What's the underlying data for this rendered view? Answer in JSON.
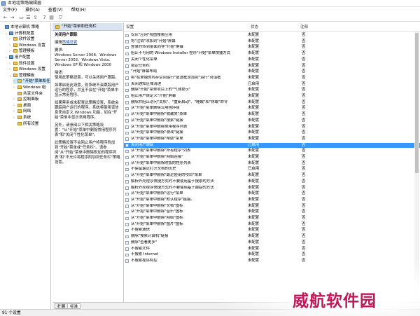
{
  "window": {
    "title": "本地组策略编辑器"
  },
  "menu": [
    "文件(F)",
    "操作(A)",
    "查看(V)",
    "帮助(H)"
  ],
  "tree": [
    {
      "label": "本地计算机 策略",
      "kind": "pc",
      "exp": "",
      "indent": 0
    },
    {
      "label": "计算机配置",
      "kind": "pc",
      "exp": "⌄",
      "indent": 1
    },
    {
      "label": "软件设置",
      "kind": "folder",
      "exp": "›",
      "indent": 2
    },
    {
      "label": "Windows 设置",
      "kind": "folder",
      "exp": "›",
      "indent": 2
    },
    {
      "label": "管理模板",
      "kind": "folder",
      "exp": "›",
      "indent": 2
    },
    {
      "label": "用户配置",
      "kind": "pc",
      "exp": "⌄",
      "indent": 1
    },
    {
      "label": "软件设置",
      "kind": "folder",
      "exp": "›",
      "indent": 2
    },
    {
      "label": "Windows 设置",
      "kind": "folder",
      "exp": "›",
      "indent": 2
    },
    {
      "label": "管理模板",
      "kind": "folder",
      "exp": "⌄",
      "indent": 2
    },
    {
      "label": "\"开始\"菜单和任",
      "kind": "folder",
      "exp": "›",
      "indent": 3,
      "selected": true
    },
    {
      "label": "Windows 组",
      "kind": "folder",
      "exp": "›",
      "indent": 3
    },
    {
      "label": "共享文件夹",
      "kind": "folder",
      "exp": "",
      "indent": 3
    },
    {
      "label": "控制面板",
      "kind": "folder",
      "exp": "›",
      "indent": 3
    },
    {
      "label": "桌面",
      "kind": "folder",
      "exp": "›",
      "indent": 3
    },
    {
      "label": "网络",
      "kind": "folder",
      "exp": "›",
      "indent": 3
    },
    {
      "label": "系统",
      "kind": "folder",
      "exp": "›",
      "indent": 3
    },
    {
      "label": "所有设置",
      "kind": "folder",
      "exp": "",
      "indent": 3
    }
  ],
  "description": {
    "header": "\"开始\"菜单和任务栏",
    "policy_title": "关闭用户跟踪",
    "edit_prefix": "编辑",
    "edit_link": "策略设置",
    "req_label": "要求:",
    "req_text": "Windows Server 2008、Windows Server 2003、Windows Vista、Windows XP 和 Windows 2000",
    "desc_label": "描述:",
    "desc_text": "使用此策略设置，可以关闭用户跟踪。",
    "p1": "如果启用此设置，则系统不会跟踪用户运行的程序，并且不会在\"开始\"菜单中显示常用程序。",
    "p2": "如果禁用或未配置此策略设置，系统会跟踪用户运行的程序。系统将使用该信息来自定义 Windows 功能，如在\"开始\"菜单中显示常用程序。",
    "p3": "另外，请参阅以下相关策略设置：\"从\"开始\"菜单中删除常用程序列表\"和\"关闭个性化菜单\"。",
    "p4": "此策略设置不会阻止用户将程序附加到\"开始\"菜单或\"任务栏\"。请参阅\"从\"开始\"菜单中删除附加的程序列表\"和\"不允许将程序附加到任务栏\"策略设置。"
  },
  "list_headers": {
    "setting": "设置",
    "state": "状态",
    "comment": "注释"
  },
  "rows": [
    {
      "name": "仅从\"应用\"视图搜索应用",
      "state": "未配置",
      "comment": "否"
    },
    {
      "name": "将\"注销\"添加到\"开始\"屏幕",
      "state": "未配置",
      "comment": "否"
    },
    {
      "name": "登录时转到桌面而非\"开始\"屏幕",
      "state": "未配置",
      "comment": "否"
    },
    {
      "name": "阻止不可用的 Windows Installer 程序\"开始\"菜单快捷方式",
      "state": "未配置",
      "comment": "否"
    },
    {
      "name": "关闭个性化菜单",
      "state": "未配置",
      "comment": "否"
    },
    {
      "name": "锁定任务栏",
      "state": "未配置",
      "comment": "否"
    },
    {
      "name": "\"开始\"屏幕布局",
      "state": "未配置",
      "comment": "否"
    },
    {
      "name": "将\"在单独的内存空间运行\"复选框添加到\"运行\"对话框",
      "state": "未配置",
      "comment": "否"
    },
    {
      "name": "关闭通知区域清理",
      "state": "已启用",
      "comment": "否"
    },
    {
      "name": "删除\"开始\"菜单项目上的\"气球提示\"",
      "state": "未配置",
      "comment": "否"
    },
    {
      "name": "阻止用户自定义\"开始\"屏幕",
      "state": "未配置",
      "comment": "否"
    },
    {
      "name": "删除并阻止访问\"关机\"、\"重新启动\"、\"睡眠\"和\"休眠\"命令",
      "state": "未配置",
      "comment": "否"
    },
    {
      "name": "从\"开始\"菜单删除公用程序组",
      "state": "未配置",
      "comment": "否"
    },
    {
      "name": "从\"开始\"菜单中删除\"收藏夹\"菜单",
      "state": "未配置",
      "comment": "否"
    },
    {
      "name": "从\"开始\"菜单中删除\"搜索\"链接",
      "state": "未配置",
      "comment": "否"
    },
    {
      "name": "从\"开始\"菜单中删除常用程序列表",
      "state": "未配置",
      "comment": "否"
    },
    {
      "name": "从\"开始\"菜单中删除\"游戏\"链接",
      "state": "未配置",
      "comment": "否"
    },
    {
      "name": "从\"开始\"菜单中删除\"帮助\"菜单",
      "state": "未配置",
      "comment": "否"
    },
    {
      "name": "关闭用户跟踪",
      "state": "已启用",
      "comment": "否",
      "selected": true
    },
    {
      "name": "从\"开始\"菜单中删除\"所有程序\"列表",
      "state": "未配置",
      "comment": "否"
    },
    {
      "name": "从\"开始\"菜单中删除\"网络连接\"",
      "state": "未配置",
      "comment": "否"
    },
    {
      "name": "从\"开始\"菜单中删除附加的程序列表",
      "state": "未配置",
      "comment": "否"
    },
    {
      "name": "不保留最近打开文档的历史",
      "state": "已启用",
      "comment": "否"
    },
    {
      "name": "从\"开始\"菜单中删除\"最近使用的项目\"菜单",
      "state": "未配置",
      "comment": "否"
    },
    {
      "name": "解析外壳程序快捷方式时不要使用基于搜索的方法",
      "state": "未配置",
      "comment": "否"
    },
    {
      "name": "解析外壳程序快捷方式时不要使用基于跟踪的方法",
      "state": "未配置",
      "comment": "否"
    },
    {
      "name": "从\"开始\"菜单中删除\"运行\"菜单",
      "state": "未配置",
      "comment": "否"
    },
    {
      "name": "从\"开始\"菜单中删除\"默认程序\"链接。",
      "state": "未配置",
      "comment": "否"
    },
    {
      "name": "从\"开始\"菜单中删除\"文档\"图标",
      "state": "未配置",
      "comment": "否"
    },
    {
      "name": "从\"开始\"菜单中删除\"音乐\"图标",
      "state": "未配置",
      "comment": "否"
    },
    {
      "name": "从\"开始\"菜单中删除\"网络\"图标",
      "state": "未配置",
      "comment": "否"
    },
    {
      "name": "从\"开始\"菜单中删除\"图片\"图标",
      "state": "未配置",
      "comment": "否"
    },
    {
      "name": "不搜索通信",
      "state": "未配置",
      "comment": "否"
    },
    {
      "name": "删除\"搜索计算机\"链接",
      "state": "未配置",
      "comment": "否"
    },
    {
      "name": "删除\"查看更多\"",
      "state": "未配置",
      "comment": "否"
    },
    {
      "name": "不搜索文件",
      "state": "未配置",
      "comment": "否"
    },
    {
      "name": "不搜索 Internet",
      "state": "未配置",
      "comment": "否"
    },
    {
      "name": "不搜索程序和控",
      "state": "未配置",
      "comment": "否"
    }
  ],
  "tabs": [
    "扩展",
    "标准"
  ],
  "status": "91 个设置",
  "watermark": "威航软件园"
}
